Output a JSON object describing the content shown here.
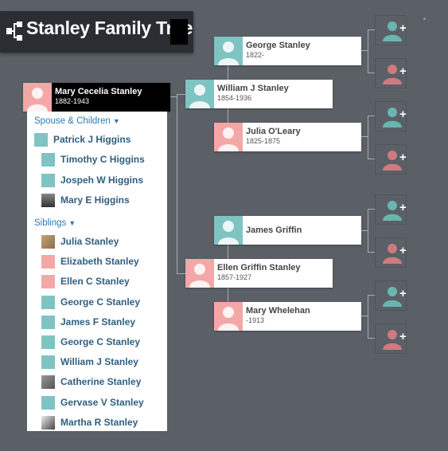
{
  "header": {
    "title": "Stanley Family Tree"
  },
  "root": {
    "name": "Mary Cecelia Stanley",
    "dates": "1882-1943",
    "gender": "female"
  },
  "parents": [
    {
      "name": "William J Stanley",
      "dates": "1854-1936",
      "gender": "male"
    },
    {
      "name": "Ellen Griffin Stanley",
      "dates": "1857-1927",
      "gender": "female"
    }
  ],
  "grandparents": [
    {
      "name": "George Stanley",
      "dates": "1822-",
      "gender": "male"
    },
    {
      "name": "Julia O'Leary",
      "dates": "1825-1875",
      "gender": "female"
    },
    {
      "name": "James Griffin",
      "dates": "",
      "gender": "male"
    },
    {
      "name": "Mary Whelehan",
      "dates": "-1913",
      "gender": "female"
    }
  ],
  "add_placeholder": {
    "plus": "+"
  },
  "panel": {
    "spouse_header": "Spouse & Children",
    "spouse": {
      "name": "Patrick J Higgins",
      "thumb": "male"
    },
    "children": [
      {
        "name": "Timothy C Higgins",
        "thumb": "male"
      },
      {
        "name": "Jospeh W Higgins",
        "thumb": "male"
      },
      {
        "name": "Mary E Higgins",
        "thumb": "photo"
      }
    ],
    "siblings_header": "Siblings",
    "siblings": [
      {
        "name": "Julia Stanley",
        "thumb": "photo"
      },
      {
        "name": "Elizabeth Stanley",
        "thumb": "female"
      },
      {
        "name": "Ellen C Stanley",
        "thumb": "female"
      },
      {
        "name": "George C Stanley",
        "thumb": "male"
      },
      {
        "name": "James F Stanley",
        "thumb": "male"
      },
      {
        "name": "George C Stanley",
        "thumb": "male"
      },
      {
        "name": "William J Stanley",
        "thumb": "male"
      },
      {
        "name": "Catherine Stanley",
        "thumb": "photo"
      },
      {
        "name": "Gervase V Stanley",
        "thumb": "male"
      },
      {
        "name": "Martha R Stanley",
        "thumb": "photo"
      }
    ]
  },
  "colors": {
    "male": "#7fc3c3",
    "female": "#f4a7a7",
    "background": "#5b5f66",
    "link": "#2f5f80"
  }
}
